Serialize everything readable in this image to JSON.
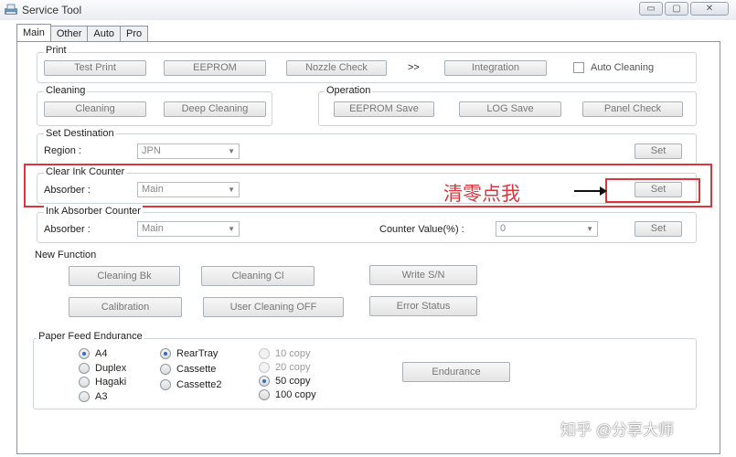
{
  "window": {
    "title": "Service Tool",
    "min": "▭",
    "max": "▢",
    "close": "✕"
  },
  "tabs": [
    "Main",
    "Other",
    "Auto",
    "Pro"
  ],
  "print": {
    "title": "Print",
    "test_print": "Test Print",
    "eeprom": "EEPROM",
    "nozzle_check": "Nozzle Check",
    "chevrons": ">>",
    "integration": "Integration",
    "auto_cleaning": "Auto Cleaning"
  },
  "cleaning": {
    "title": "Cleaning",
    "cleaning": "Cleaning",
    "deep_cleaning": "Deep Cleaning"
  },
  "operation": {
    "title": "Operation",
    "eeprom_save": "EEPROM Save",
    "log_save": "LOG Save",
    "panel_check": "Panel Check"
  },
  "set_destination": {
    "title": "Set Destination",
    "region_label": "Region :",
    "region_value": "JPN",
    "set": "Set"
  },
  "clear_ink": {
    "title": "Clear Ink Counter",
    "absorber_label": "Absorber :",
    "absorber_value": "Main",
    "set": "Set",
    "annotation": "清零点我"
  },
  "ink_absorber": {
    "title": "Ink Absorber Counter",
    "absorber_label": "Absorber :",
    "absorber_value": "Main",
    "counter_label": "Counter Value(%) :",
    "counter_value": "0",
    "set": "Set"
  },
  "new_function": {
    "title": "New Function",
    "cleaning_bk": "Cleaning Bk",
    "cleaning_cl": "Cleaning Cl",
    "write_sn": "Write S/N",
    "calibration": "Calibration",
    "user_cleaning_off": "User Cleaning OFF",
    "error_status": "Error Status"
  },
  "paper_feed": {
    "title": "Paper Feed Endurance",
    "size": [
      {
        "label": "A4",
        "checked": true
      },
      {
        "label": "Duplex",
        "checked": false
      },
      {
        "label": "Hagaki",
        "checked": false
      },
      {
        "label": "A3",
        "checked": false
      }
    ],
    "tray": [
      {
        "label": "RearTray",
        "checked": true
      },
      {
        "label": "Cassette",
        "checked": false
      },
      {
        "label": "Cassette2",
        "checked": false
      }
    ],
    "copies": [
      {
        "label": "10 copy",
        "checked": false,
        "disabled": true
      },
      {
        "label": "20 copy",
        "checked": false,
        "disabled": true
      },
      {
        "label": "50 copy",
        "checked": true,
        "disabled": false
      },
      {
        "label": "100 copy",
        "checked": false,
        "disabled": false
      }
    ],
    "endurance": "Endurance"
  },
  "watermark": "知乎 @分享大师"
}
